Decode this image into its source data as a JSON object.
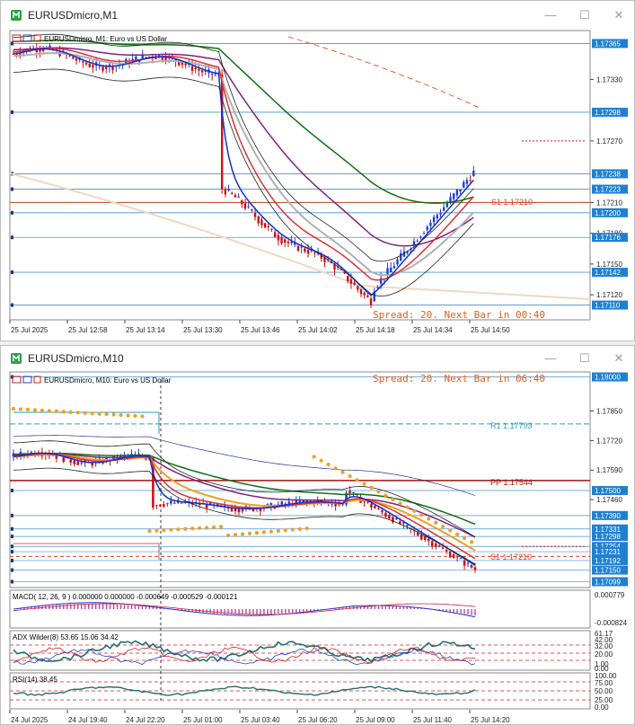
{
  "windows": [
    {
      "title": "EURUSDmicro,M1",
      "chart_label": "EURUSDmicro, M1:  Euro vs US Dollar",
      "spread": "Spread: 20. Next Bar in 00:40",
      "price_axis": [
        "1.17365",
        "1.17330",
        "1.17298",
        "1.17270",
        "1.17238",
        "1.17223",
        "1.17210",
        "1.17200",
        "1.17180",
        "1.17176",
        "1.17150",
        "1.17142",
        "1.17120",
        "1.17110"
      ],
      "highlighted_prices": [
        "1.17365",
        "1.17298",
        "1.17238",
        "1.17223",
        "1.17200",
        "1.17176",
        "1.17142",
        "1.17110"
      ],
      "time_axis": [
        "25 Jul 2025",
        "25 Jul 12:58",
        "25 Jul 13:14",
        "25 Jul 13:30",
        "25 Jul 13:46",
        "25 Jul 14:02",
        "25 Jul 14:18",
        "25 Jul 14:34",
        "25 Jul 14:50"
      ],
      "pivot": {
        "label": "S1 1.17210",
        "color": "#e04020"
      }
    },
    {
      "title": "EURUSDmicro,M10",
      "chart_label": "EURUSDmicro, M10:  Euro vs US Dollar",
      "spread": "Spread: 20. Next Bar in 06:40",
      "price_axis": [
        "1.18000",
        "1.17850",
        "1.17720",
        "1.17590",
        "1.17500",
        "1.17460",
        "1.17390",
        "1.17331",
        "1.17298",
        "1.17254",
        "1.17231",
        "1.17192",
        "1.17150",
        "1.17099"
      ],
      "highlighted_prices": [
        "1.18000",
        "1.17500",
        "1.17390",
        "1.17331",
        "1.17298",
        "1.17254",
        "1.17231",
        "1.17192",
        "1.17150",
        "1.17099"
      ],
      "time_axis": [
        "24 Jul 2025",
        "24 Jul 19:40",
        "24 Jul 22:20",
        "25 Jul 01:00",
        "25 Jul 03:40",
        "25 Jul 06:20",
        "25 Jul 09:00",
        "25 Jul 11:40",
        "25 Jul 14:20"
      ],
      "pivots": [
        {
          "label": "R1 1.17793",
          "color": "#20a0c0"
        },
        {
          "label": "PP 1.17544",
          "color": "#a01010"
        },
        {
          "label": "S1 1.17210",
          "color": "#e04020"
        }
      ],
      "macd": {
        "label": "MACD( 12, 26, 9 ) 0.000000 0.000000 -0.000649 -0.000529 -0.000121",
        "scale": [
          "0.000779",
          "-0.000824"
        ]
      },
      "adx": {
        "label": "ADX Wilder(8) 53.65 15.06 34.42",
        "scale": [
          "61.17",
          "42.00",
          "32.00",
          "20.00",
          "1.00",
          "0.00"
        ]
      },
      "rsi": {
        "label": "RSI(14) 38.45",
        "scale": [
          "100.00",
          "75.00",
          "50.00",
          "25.00",
          "0.00"
        ]
      }
    }
  ],
  "colors": {
    "bull": "#1f3fd0",
    "bear": "#d01010",
    "ma_fast": "#1030d0",
    "ma_red": "#e03030",
    "ma_purple": "#802080",
    "ma_green": "#107010",
    "ma_grey": "#b0b0b0",
    "bands": "#000000",
    "sar": "#f0a020",
    "highlight_tag": "#2080d0",
    "pivot_tag": "#d02020"
  },
  "icons": [
    "mt-app-icon",
    "minimize-icon",
    "maximize-icon",
    "close-icon"
  ]
}
